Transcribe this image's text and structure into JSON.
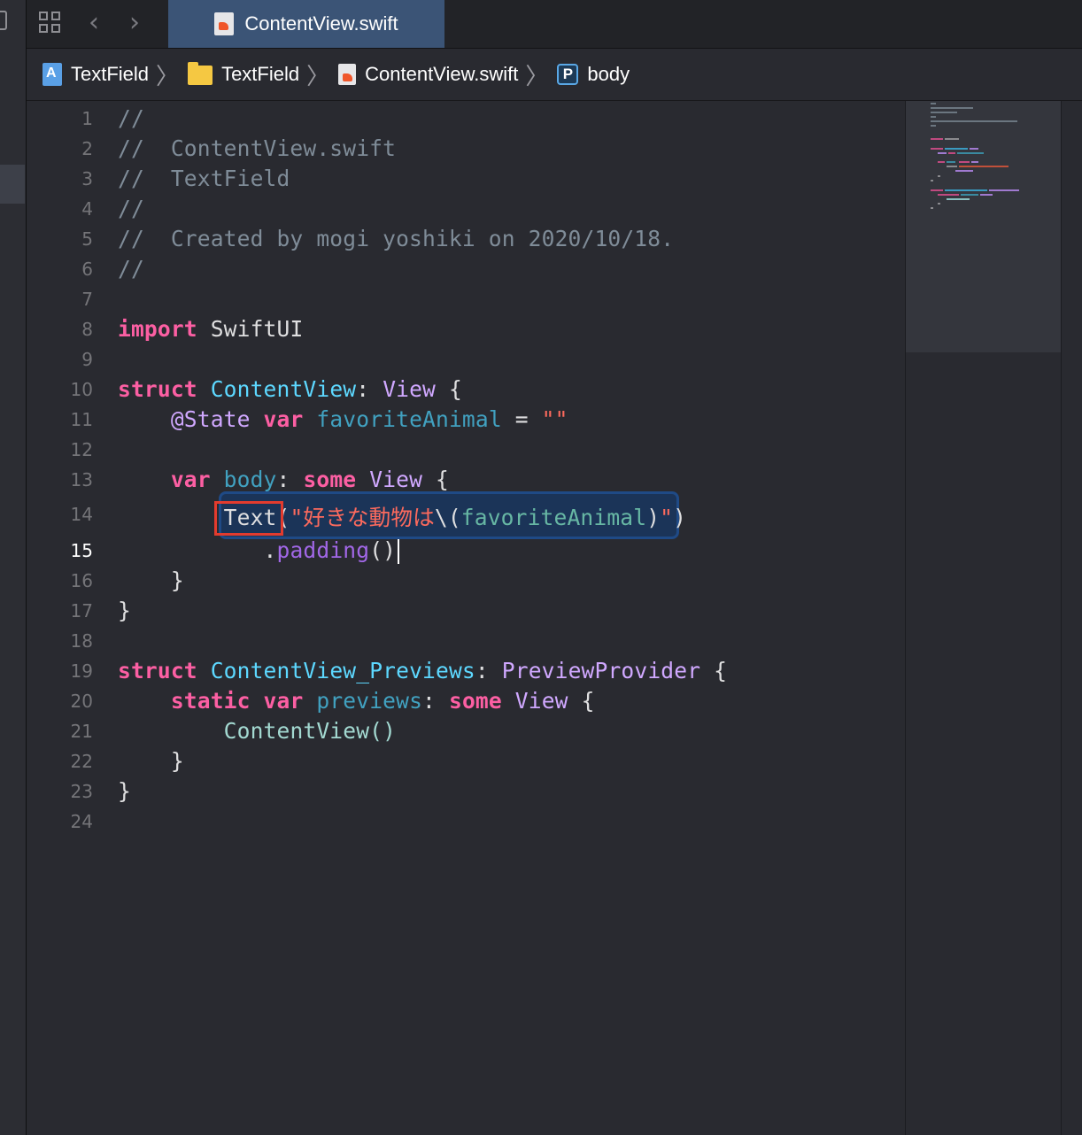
{
  "tab": {
    "label": "ContentView.swift"
  },
  "jumpbar": {
    "project": "TextField",
    "folder": "TextField",
    "file": "ContentView.swift",
    "symbol_badge": "P",
    "symbol": "body"
  },
  "code": {
    "lines": [
      {
        "n": "1"
      },
      {
        "n": "2"
      },
      {
        "n": "3"
      },
      {
        "n": "4"
      },
      {
        "n": "5"
      },
      {
        "n": "6"
      },
      {
        "n": "7"
      },
      {
        "n": "8"
      },
      {
        "n": "9"
      },
      {
        "n": "10"
      },
      {
        "n": "11"
      },
      {
        "n": "12"
      },
      {
        "n": "13"
      },
      {
        "n": "14"
      },
      {
        "n": "15"
      },
      {
        "n": "16"
      },
      {
        "n": "17"
      },
      {
        "n": "18"
      },
      {
        "n": "19"
      },
      {
        "n": "20"
      },
      {
        "n": "21"
      },
      {
        "n": "22"
      },
      {
        "n": "23"
      },
      {
        "n": "24"
      }
    ],
    "t": {
      "c1": "//",
      "c2": "//  ContentView.swift",
      "c3": "//  TextField",
      "c4": "//",
      "c5": "//  Created by mogi yoshiki on 2020/10/18.",
      "c6": "//",
      "import_kw": "import",
      "import_mod": " SwiftUI",
      "struct_kw": "struct",
      "content_view": "ContentView",
      "colon": ":",
      "view": "View",
      "brace_open": " {",
      "state_attr": "@State",
      "var_kw": "var",
      "favorite_animal": "favoriteAnimal",
      "assign": " = ",
      "empty_str": "\"\"",
      "body": "body",
      "some_kw": "some",
      "text_call": "Text",
      "paren_open": "(",
      "str_open": "\"好きな動物は",
      "interp_open": "\\(",
      "interp_close": ")",
      "str_close": "\"",
      "paren_close": ")",
      "dot": ".",
      "padding": "padding",
      "call_parens": "()",
      "brace_close": "}",
      "previews_struct": "ContentView_Previews",
      "preview_provider": "PreviewProvider",
      "static_kw": "static",
      "previews": "previews",
      "content_view_call": "ContentView()"
    }
  },
  "colors": {
    "keyword": "#fc5fa3",
    "comment": "#7f8c98",
    "string": "#fc6a5d",
    "type": "#d0a8ff",
    "declared_type": "#5dd8ff",
    "property": "#67b7a4",
    "method": "#a167e6",
    "annotation_box": "#e33b2e",
    "selection": "#1f4a86"
  },
  "icons": {
    "navigator": "sidebar-icon",
    "grid": "related-items-icon",
    "back": "chevron-left-icon",
    "forward": "chevron-right-icon",
    "swift_file": "swift-file-icon",
    "project": "xcode-project-icon",
    "folder": "folder-icon"
  }
}
